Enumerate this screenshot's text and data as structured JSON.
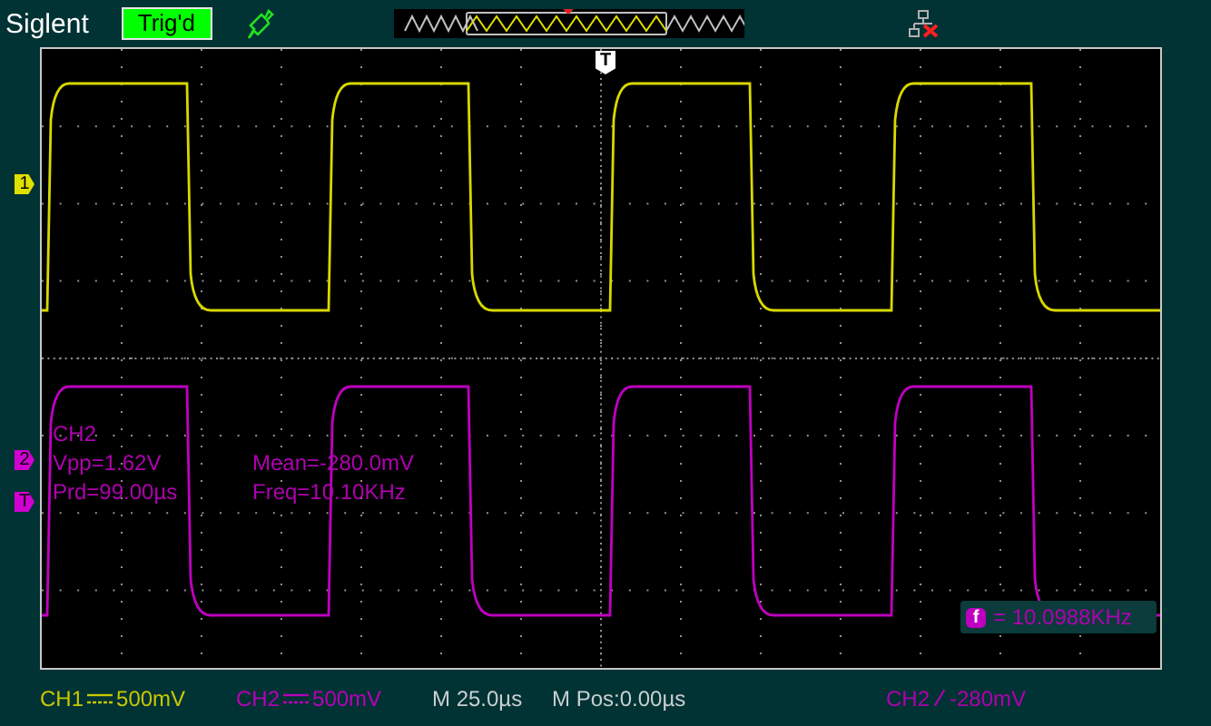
{
  "header": {
    "brand": "Siglent",
    "trigger_status": "Trig'd"
  },
  "screen": {
    "trigger_position_marker": "T",
    "channel_markers": [
      {
        "label": "1",
        "color": "#e0e000"
      },
      {
        "label": "2",
        "color": "#d000d0"
      },
      {
        "label": "T",
        "color": "#d000d0"
      }
    ],
    "measurements": {
      "title": "CH2",
      "items": [
        "Vpp=1.62V",
        "Mean=-280.0mV",
        "Prd=99.00µs",
        "Freq=10.10KHz"
      ]
    },
    "frequency_counter": {
      "icon": "f",
      "value": "= 10.0988KHz"
    }
  },
  "footer": {
    "channels": [
      {
        "name": "CH1",
        "scale": "500mV",
        "color": "#c8c800"
      },
      {
        "name": "CH2",
        "scale": "500mV",
        "color": "#b800b8"
      }
    ],
    "timebase": "M 25.0µs",
    "position": "M Pos:0.00µs",
    "trigger": {
      "source": "CH2",
      "level": "-280mV"
    }
  }
}
